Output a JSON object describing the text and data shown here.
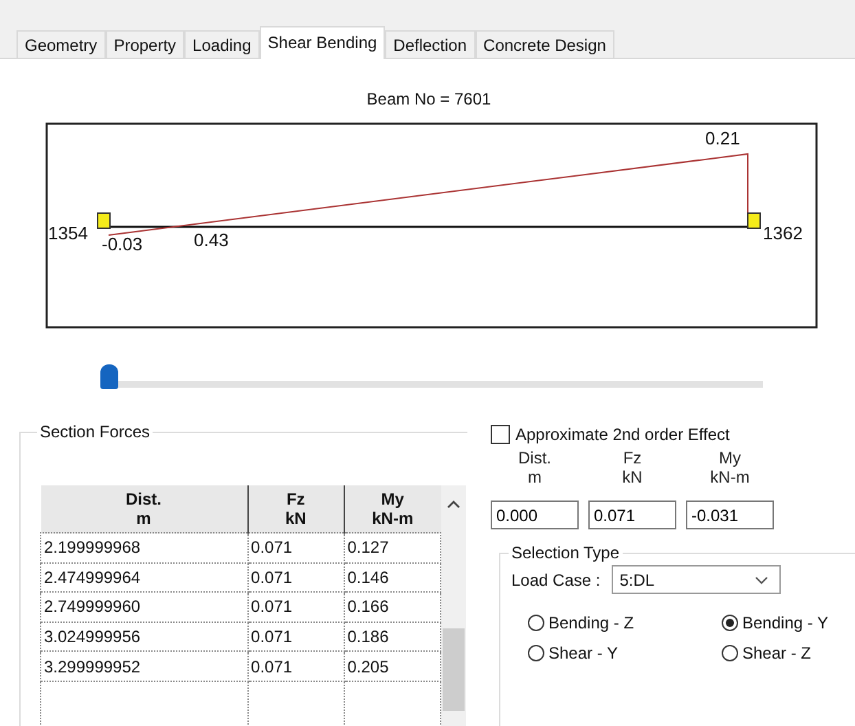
{
  "tabs": [
    {
      "label": "Geometry",
      "selected": false
    },
    {
      "label": "Property",
      "selected": false
    },
    {
      "label": "Loading",
      "selected": false
    },
    {
      "label": "Shear Bending",
      "selected": true
    },
    {
      "label": "Deflection",
      "selected": false
    },
    {
      "label": "Concrete Design",
      "selected": false
    }
  ],
  "diagram": {
    "title": "Beam No = 7601",
    "start_node": "1354",
    "end_node": "1362",
    "labels": [
      "-0.03",
      "0.43",
      "0.21"
    ]
  },
  "slider": {
    "level": 0
  },
  "section_forces": {
    "title": "Section Forces",
    "columns": [
      "Dist.\nm",
      "Fz\nkN",
      "My\nkN-m"
    ],
    "rows": [
      [
        "2.199999968",
        "0.071",
        "0.127"
      ],
      [
        "2.474999964",
        "0.071",
        "0.146"
      ],
      [
        "2.749999960",
        "0.071",
        "0.166"
      ],
      [
        "3.024999956",
        "0.071",
        "0.186"
      ],
      [
        "3.299999952",
        "0.071",
        "0.205"
      ]
    ]
  },
  "second_order": {
    "label": "Approximate 2nd order Effect",
    "checked": false
  },
  "values": [
    {
      "heading": [
        "Dist.",
        "m"
      ],
      "value": "0.000"
    },
    {
      "heading": [
        "Fz",
        "kN"
      ],
      "value": "0.071"
    },
    {
      "heading": [
        "My",
        "kN-m"
      ],
      "value": "-0.031"
    }
  ],
  "selection_type": {
    "title": "Selection Type",
    "load_case_label": "Load Case :",
    "load_case": "5:DL",
    "options": [
      {
        "label": "Bending - Z",
        "selected": false
      },
      {
        "label": "Bending - Y",
        "selected": true
      },
      {
        "label": "Shear - Y",
        "selected": false
      },
      {
        "label": "Shear - Z",
        "selected": false
      }
    ]
  }
}
